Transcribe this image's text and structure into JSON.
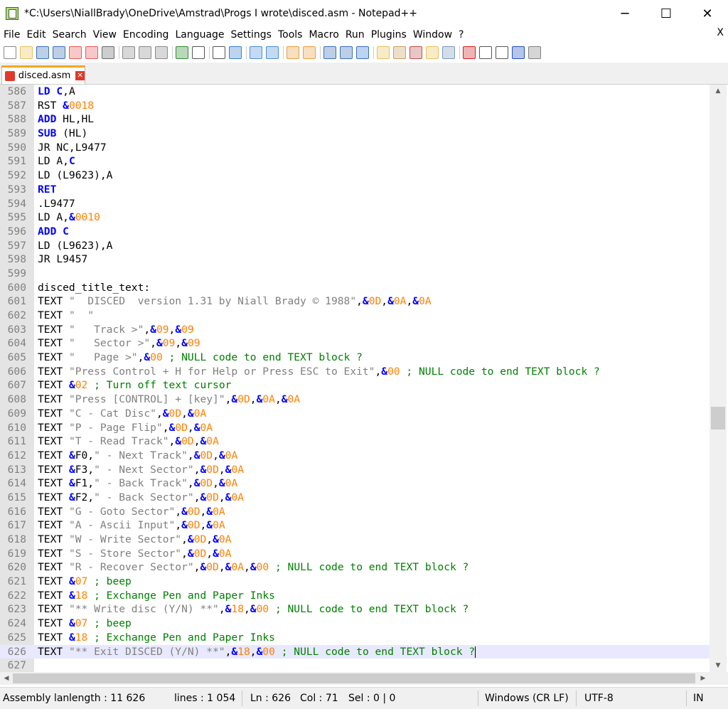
{
  "window": {
    "title": "*C:\\Users\\NiallBrady\\OneDrive\\Amstrad\\Progs I wrote\\disced.asm - Notepad++",
    "minimize": "─",
    "maximize": "☐",
    "close": "✕"
  },
  "menu": [
    "File",
    "Edit",
    "Search",
    "View",
    "Encoding",
    "Language",
    "Settings",
    "Tools",
    "Macro",
    "Run",
    "Plugins",
    "Window",
    "?"
  ],
  "menu_close": "X",
  "tab": {
    "label": "disced.asm",
    "close": "✕"
  },
  "toolbar_icons": [
    "new-file-icon",
    "open-file-icon",
    "save-icon",
    "save-all-icon",
    "close-icon",
    "close-all-icon",
    "print-icon",
    "cut-icon",
    "copy-icon",
    "paste-icon",
    "undo-icon",
    "redo-icon",
    "find-icon",
    "replace-icon",
    "zoom-in-icon",
    "zoom-out-icon",
    "sync-vertical-icon",
    "sync-horizontal-icon",
    "word-wrap-icon",
    "show-all-chars-icon",
    "indent-guide-icon",
    "user-language-icon",
    "document-map-icon",
    "function-list-icon",
    "folder-workspace-icon",
    "monitoring-icon",
    "record-macro-icon",
    "stop-macro-icon",
    "play-macro-icon",
    "run-macro-multiple-icon",
    "save-macro-icon"
  ],
  "editor": {
    "lines": [
      {
        "n": "586",
        "t": [
          [
            "kw",
            "LD "
          ],
          [
            "kw",
            "C"
          ],
          [
            "p",
            ",A"
          ]
        ]
      },
      {
        "n": "587",
        "t": [
          [
            "p",
            "RST "
          ],
          [
            "kw",
            "&"
          ],
          [
            "num",
            "0018"
          ]
        ]
      },
      {
        "n": "588",
        "t": [
          [
            "kw",
            "ADD"
          ],
          [
            "p",
            " HL,HL"
          ]
        ]
      },
      {
        "n": "589",
        "t": [
          [
            "kw",
            "SUB"
          ],
          [
            "p",
            " (HL)"
          ]
        ]
      },
      {
        "n": "590",
        "t": [
          [
            "p",
            "JR NC,L9477"
          ]
        ]
      },
      {
        "n": "591",
        "t": [
          [
            "p",
            "LD A,"
          ],
          [
            "kw",
            "C"
          ]
        ]
      },
      {
        "n": "592",
        "t": [
          [
            "p",
            "LD (L9623),A"
          ]
        ]
      },
      {
        "n": "593",
        "t": [
          [
            "kw",
            "RET"
          ]
        ]
      },
      {
        "n": "594",
        "t": [
          [
            "p",
            ".L9477"
          ]
        ]
      },
      {
        "n": "595",
        "t": [
          [
            "p",
            "LD A,"
          ],
          [
            "kw",
            "&"
          ],
          [
            "num",
            "0010"
          ]
        ]
      },
      {
        "n": "596",
        "t": [
          [
            "kw",
            "ADD C"
          ]
        ]
      },
      {
        "n": "597",
        "t": [
          [
            "p",
            "LD (L9623),A"
          ]
        ]
      },
      {
        "n": "598",
        "t": [
          [
            "p",
            "JR L9457"
          ]
        ]
      },
      {
        "n": "599",
        "t": []
      },
      {
        "n": "600",
        "t": [
          [
            "p",
            "disced_title_text:"
          ]
        ]
      },
      {
        "n": "601",
        "t": [
          [
            "p",
            "TEXT "
          ],
          [
            "str",
            "\"  DISCED  version 1.31 by Niall Brady © 1988\""
          ],
          [
            "p",
            ","
          ],
          [
            "kw",
            "&"
          ],
          [
            "num",
            "0D"
          ],
          [
            "p",
            ","
          ],
          [
            "kw",
            "&"
          ],
          [
            "num",
            "0A"
          ],
          [
            "p",
            ","
          ],
          [
            "kw",
            "&"
          ],
          [
            "num",
            "0A"
          ]
        ]
      },
      {
        "n": "602",
        "t": [
          [
            "p",
            "TEXT "
          ],
          [
            "str",
            "\"  \""
          ]
        ]
      },
      {
        "n": "603",
        "t": [
          [
            "p",
            "TEXT "
          ],
          [
            "str",
            "\"   Track >\""
          ],
          [
            "p",
            ","
          ],
          [
            "kw",
            "&"
          ],
          [
            "num",
            "09"
          ],
          [
            "p",
            ","
          ],
          [
            "kw",
            "&"
          ],
          [
            "num",
            "09"
          ]
        ]
      },
      {
        "n": "604",
        "t": [
          [
            "p",
            "TEXT "
          ],
          [
            "str",
            "\"   Sector >\""
          ],
          [
            "p",
            ","
          ],
          [
            "kw",
            "&"
          ],
          [
            "num",
            "09"
          ],
          [
            "p",
            ","
          ],
          [
            "kw",
            "&"
          ],
          [
            "num",
            "09"
          ]
        ]
      },
      {
        "n": "605",
        "t": [
          [
            "p",
            "TEXT "
          ],
          [
            "str",
            "\"   Page >\""
          ],
          [
            "p",
            ","
          ],
          [
            "kw",
            "&"
          ],
          [
            "num",
            "00"
          ],
          [
            "com",
            " ; NULL code to end TEXT block ?"
          ]
        ]
      },
      {
        "n": "606",
        "t": [
          [
            "p",
            "TEXT "
          ],
          [
            "str",
            "\"Press Control + H for Help or Press ESC to Exit\""
          ],
          [
            "p",
            ","
          ],
          [
            "kw",
            "&"
          ],
          [
            "num",
            "00"
          ],
          [
            "com",
            " ; NULL code to end TEXT block ?"
          ]
        ]
      },
      {
        "n": "607",
        "t": [
          [
            "p",
            "TEXT "
          ],
          [
            "kw",
            "&"
          ],
          [
            "num",
            "02"
          ],
          [
            "com",
            " ; Turn off text cursor"
          ]
        ]
      },
      {
        "n": "608",
        "t": [
          [
            "p",
            "TEXT "
          ],
          [
            "str",
            "\"Press [CONTROL] + [key]\""
          ],
          [
            "p",
            ","
          ],
          [
            "kw",
            "&"
          ],
          [
            "num",
            "0D"
          ],
          [
            "p",
            ","
          ],
          [
            "kw",
            "&"
          ],
          [
            "num",
            "0A"
          ],
          [
            "p",
            ","
          ],
          [
            "kw",
            "&"
          ],
          [
            "num",
            "0A"
          ]
        ]
      },
      {
        "n": "609",
        "t": [
          [
            "p",
            "TEXT "
          ],
          [
            "str",
            "\"C - Cat Disc\""
          ],
          [
            "p",
            ","
          ],
          [
            "kw",
            "&"
          ],
          [
            "num",
            "0D"
          ],
          [
            "p",
            ","
          ],
          [
            "kw",
            "&"
          ],
          [
            "num",
            "0A"
          ]
        ]
      },
      {
        "n": "610",
        "t": [
          [
            "p",
            "TEXT "
          ],
          [
            "str",
            "\"P - Page Flip\""
          ],
          [
            "p",
            ","
          ],
          [
            "kw",
            "&"
          ],
          [
            "num",
            "0D"
          ],
          [
            "p",
            ","
          ],
          [
            "kw",
            "&"
          ],
          [
            "num",
            "0A"
          ]
        ]
      },
      {
        "n": "611",
        "t": [
          [
            "p",
            "TEXT "
          ],
          [
            "str",
            "\"T - Read Track\""
          ],
          [
            "p",
            ","
          ],
          [
            "kw",
            "&"
          ],
          [
            "num",
            "0D"
          ],
          [
            "p",
            ","
          ],
          [
            "kw",
            "&"
          ],
          [
            "num",
            "0A"
          ]
        ]
      },
      {
        "n": "612",
        "t": [
          [
            "p",
            "TEXT "
          ],
          [
            "kw",
            "&"
          ],
          [
            "p",
            "F0,"
          ],
          [
            "str",
            "\" - Next Track\""
          ],
          [
            "p",
            ","
          ],
          [
            "kw",
            "&"
          ],
          [
            "num",
            "0D"
          ],
          [
            "p",
            ","
          ],
          [
            "kw",
            "&"
          ],
          [
            "num",
            "0A"
          ]
        ]
      },
      {
        "n": "613",
        "t": [
          [
            "p",
            "TEXT "
          ],
          [
            "kw",
            "&"
          ],
          [
            "p",
            "F3,"
          ],
          [
            "str",
            "\" - Next Sector\""
          ],
          [
            "p",
            ","
          ],
          [
            "kw",
            "&"
          ],
          [
            "num",
            "0D"
          ],
          [
            "p",
            ","
          ],
          [
            "kw",
            "&"
          ],
          [
            "num",
            "0A"
          ]
        ]
      },
      {
        "n": "614",
        "t": [
          [
            "p",
            "TEXT "
          ],
          [
            "kw",
            "&"
          ],
          [
            "p",
            "F1,"
          ],
          [
            "str",
            "\" - Back Track\""
          ],
          [
            "p",
            ","
          ],
          [
            "kw",
            "&"
          ],
          [
            "num",
            "0D"
          ],
          [
            "p",
            ","
          ],
          [
            "kw",
            "&"
          ],
          [
            "num",
            "0A"
          ]
        ]
      },
      {
        "n": "615",
        "t": [
          [
            "p",
            "TEXT "
          ],
          [
            "kw",
            "&"
          ],
          [
            "p",
            "F2,"
          ],
          [
            "str",
            "\" - Back Sector\""
          ],
          [
            "p",
            ","
          ],
          [
            "kw",
            "&"
          ],
          [
            "num",
            "0D"
          ],
          [
            "p",
            ","
          ],
          [
            "kw",
            "&"
          ],
          [
            "num",
            "0A"
          ]
        ]
      },
      {
        "n": "616",
        "t": [
          [
            "p",
            "TEXT "
          ],
          [
            "str",
            "\"G - Goto Sector\""
          ],
          [
            "p",
            ","
          ],
          [
            "kw",
            "&"
          ],
          [
            "num",
            "0D"
          ],
          [
            "p",
            ","
          ],
          [
            "kw",
            "&"
          ],
          [
            "num",
            "0A"
          ]
        ]
      },
      {
        "n": "617",
        "t": [
          [
            "p",
            "TEXT "
          ],
          [
            "str",
            "\"A - Ascii Input\""
          ],
          [
            "p",
            ","
          ],
          [
            "kw",
            "&"
          ],
          [
            "num",
            "0D"
          ],
          [
            "p",
            ","
          ],
          [
            "kw",
            "&"
          ],
          [
            "num",
            "0A"
          ]
        ]
      },
      {
        "n": "618",
        "t": [
          [
            "p",
            "TEXT "
          ],
          [
            "str",
            "\"W - Write Sector\""
          ],
          [
            "p",
            ","
          ],
          [
            "kw",
            "&"
          ],
          [
            "num",
            "0D"
          ],
          [
            "p",
            ","
          ],
          [
            "kw",
            "&"
          ],
          [
            "num",
            "0A"
          ]
        ]
      },
      {
        "n": "619",
        "t": [
          [
            "p",
            "TEXT "
          ],
          [
            "str",
            "\"S - Store Sector\""
          ],
          [
            "p",
            ","
          ],
          [
            "kw",
            "&"
          ],
          [
            "num",
            "0D"
          ],
          [
            "p",
            ","
          ],
          [
            "kw",
            "&"
          ],
          [
            "num",
            "0A"
          ]
        ]
      },
      {
        "n": "620",
        "t": [
          [
            "p",
            "TEXT "
          ],
          [
            "str",
            "\"R - Recover Sector\""
          ],
          [
            "p",
            ","
          ],
          [
            "kw",
            "&"
          ],
          [
            "num",
            "0D"
          ],
          [
            "p",
            ","
          ],
          [
            "kw",
            "&"
          ],
          [
            "num",
            "0A"
          ],
          [
            "p",
            ","
          ],
          [
            "kw",
            "&"
          ],
          [
            "num",
            "00"
          ],
          [
            "com",
            " ; NULL code to end TEXT block ?"
          ]
        ]
      },
      {
        "n": "621",
        "t": [
          [
            "p",
            "TEXT "
          ],
          [
            "kw",
            "&"
          ],
          [
            "num",
            "07"
          ],
          [
            "com",
            " ; beep"
          ]
        ]
      },
      {
        "n": "622",
        "t": [
          [
            "p",
            "TEXT "
          ],
          [
            "kw",
            "&"
          ],
          [
            "num",
            "18"
          ],
          [
            "com",
            " ; Exchange Pen and Paper Inks"
          ]
        ]
      },
      {
        "n": "623",
        "t": [
          [
            "p",
            "TEXT "
          ],
          [
            "str",
            "\"** Write disc (Y/N) **\""
          ],
          [
            "p",
            ","
          ],
          [
            "kw",
            "&"
          ],
          [
            "num",
            "18"
          ],
          [
            "p",
            ","
          ],
          [
            "kw",
            "&"
          ],
          [
            "num",
            "00"
          ],
          [
            "com",
            " ; NULL code to end TEXT block ?"
          ]
        ]
      },
      {
        "n": "624",
        "t": [
          [
            "p",
            "TEXT "
          ],
          [
            "kw",
            "&"
          ],
          [
            "num",
            "07"
          ],
          [
            "com",
            " ; beep"
          ]
        ]
      },
      {
        "n": "625",
        "t": [
          [
            "p",
            "TEXT "
          ],
          [
            "kw",
            "&"
          ],
          [
            "num",
            "18"
          ],
          [
            "com",
            " ; Exchange Pen and Paper Inks"
          ]
        ]
      },
      {
        "n": "626",
        "t": [
          [
            "p",
            "TEXT "
          ],
          [
            "str",
            "\"** Exit DISCED (Y/N) **\""
          ],
          [
            "p",
            ","
          ],
          [
            "kw",
            "&"
          ],
          [
            "num",
            "18"
          ],
          [
            "p",
            ","
          ],
          [
            "kw",
            "&"
          ],
          [
            "num",
            "00"
          ],
          [
            "com",
            " ; NULL code to end TEXT block ?"
          ]
        ],
        "current": true
      },
      {
        "n": "627",
        "t": []
      }
    ]
  },
  "status": {
    "language": "Assembly lang",
    "length": "length : 11 626",
    "lines": "lines : 1 054",
    "ln": "Ln : 626",
    "col": "Col : 71",
    "sel": "Sel : 0 | 0",
    "eol": "Windows (CR LF)",
    "encoding": "UTF-8",
    "mode": "IN"
  },
  "colors": {
    "keyword": "#0000ff",
    "string": "#808080",
    "number": "#ff8000",
    "comment": "#008000",
    "current_line": "#e8e8ff",
    "tab_accent": "#f5a623"
  }
}
